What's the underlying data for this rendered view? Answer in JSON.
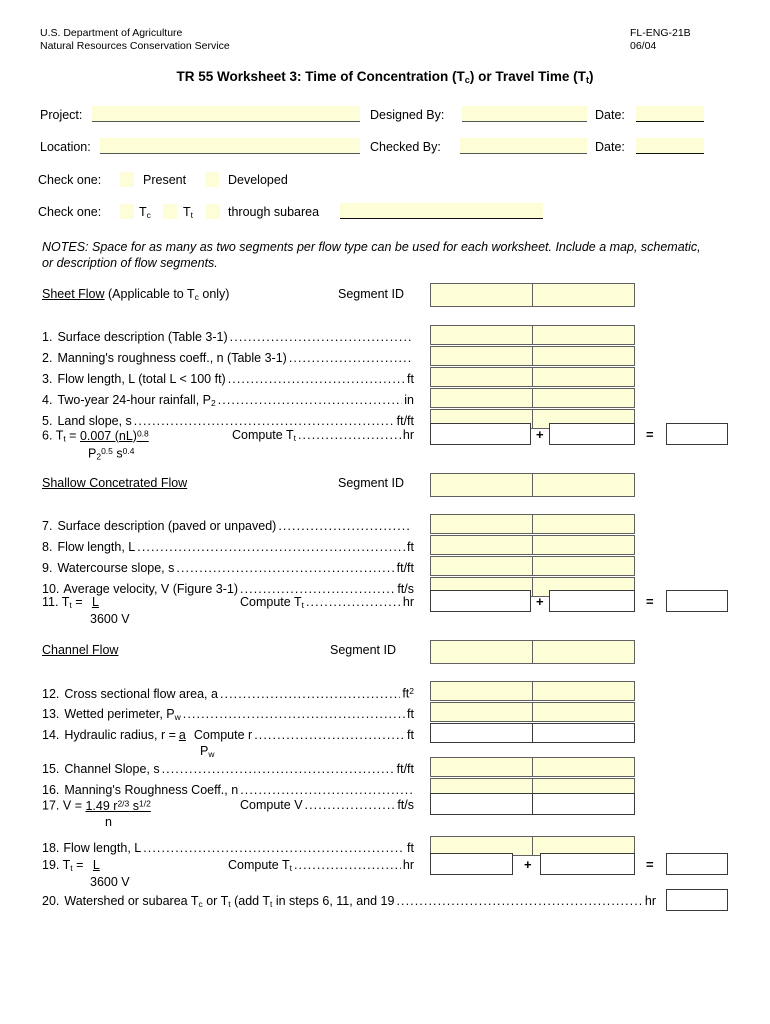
{
  "header": {
    "agency_line1": "U.S. Department of Agriculture",
    "agency_line2": "Natural Resources Conservation Service",
    "form_number": "FL-ENG-21B",
    "form_date": "06/04",
    "title_prefix": "TR 55 Worksheet 3:  Time of Concentration (T",
    "title_sub1": "c",
    "title_mid": ") or Travel Time (T",
    "title_sub2": "t",
    "title_suffix": ")"
  },
  "fields": {
    "project_label": "Project:",
    "project_value": "",
    "location_label": "Location:",
    "location_value": "",
    "designed_by_label": "Designed By:",
    "designed_by_value": "",
    "checked_by_label": "Checked By:",
    "checked_by_value": "",
    "date1_label": "Date:",
    "date1_value": "",
    "date2_label": "Date:",
    "date2_value": ""
  },
  "check_rows": {
    "row1_label": "Check one:",
    "present_label": "Present",
    "developed_label": "Developed",
    "row2_label": "Check one:",
    "tc_label": "T",
    "tc_sub": "c",
    "tt_label": "T",
    "tt_sub": "t",
    "subarea_label": "through subarea",
    "subarea_value": ""
  },
  "notes": {
    "line1": "NOTES:  Space for as many as two segments per flow type can be used for each worksheet.   Include a map, schematic,",
    "line2": "or description of flow segments."
  },
  "sections": {
    "sheet_flow": {
      "title": "Sheet Flow",
      "title_rest_a": " (Applicable to T",
      "title_rest_sub": "c",
      "title_rest_b": " only)",
      "segment_id_label": "Segment ID",
      "segment_a": "",
      "segment_b": ""
    },
    "shallow_flow": {
      "title": "Shallow Concetrated Flow",
      "segment_id_label": "Segment ID",
      "segment_a": "",
      "segment_b": ""
    },
    "channel_flow": {
      "title": "Channel Flow",
      "segment_id_label": "Segment ID",
      "segment_a": "",
      "segment_b": ""
    }
  },
  "items": {
    "i1": {
      "num": "1.",
      "text": "Surface description (Table 3-1)",
      "unit": "",
      "a": "",
      "b": ""
    },
    "i2": {
      "num": "2.",
      "text": "Manning's roughness coeff., n (Table 3-1)",
      "unit": "",
      "a": "",
      "b": ""
    },
    "i3": {
      "num": "3.",
      "text": "Flow length, L (total L < 100 ft)",
      "unit": "ft",
      "a": "",
      "b": ""
    },
    "i4": {
      "num": "4.",
      "text": "Two-year 24-hour rainfall, P",
      "text_sub": "2",
      "unit": "in",
      "a": "",
      "b": ""
    },
    "i5": {
      "num": "5.",
      "text": "Land slope, s",
      "unit": "ft/ft",
      "a": "",
      "b": ""
    },
    "i6": {
      "num": "6.",
      "var": "T",
      "var_sub": "t",
      "eq": " = ",
      "numerator": "0.007 (nL)",
      "numerator_sup": "0.8",
      "denominator_p": "P",
      "denominator_p_sub": "2",
      "denominator_p_sup": "0.5",
      "denominator_s": " s",
      "denominator_s_sup": "0.4",
      "compute": "Compute T",
      "compute_sub": "t",
      "unit": "hr",
      "a": "",
      "b": "",
      "result": "",
      "plus": "+",
      "equals": "="
    },
    "i7": {
      "num": "7.",
      "text": "Surface description (paved or unpaved)",
      "unit": "",
      "a": "",
      "b": ""
    },
    "i8": {
      "num": "8.",
      "text": "Flow length, L",
      "unit": "ft",
      "a": "",
      "b": ""
    },
    "i9": {
      "num": "9.",
      "text": "Watercourse slope, s",
      "unit": "ft/ft",
      "a": "",
      "b": ""
    },
    "i10": {
      "num": "10.",
      "text": "Average velocity, V (Figure 3-1)",
      "unit": "ft/s",
      "a": "",
      "b": ""
    },
    "i11": {
      "num": "11.",
      "var": "T",
      "var_sub": "t",
      "eq": " = ",
      "numerator": "L",
      "denominator": "3600 V",
      "compute": "Compute T",
      "compute_sub": "t",
      "unit": "hr",
      "a": "",
      "b": "",
      "result": "",
      "plus": "+",
      "equals": "="
    },
    "i12": {
      "num": "12.",
      "text": "Cross sectional flow area, a",
      "unit": "ft",
      "unit_sup": "2",
      "a": "",
      "b": ""
    },
    "i13": {
      "num": "13.",
      "text": "Wetted perimeter, P",
      "text_sub": "w",
      "unit": "ft",
      "a": "",
      "b": ""
    },
    "i14": {
      "num": "14.",
      "text": "Hydraulic radius, r = ",
      "numerator": "a",
      "denominator_p": "P",
      "denominator_sub": "w",
      "compute": "Compute r",
      "unit": "ft",
      "a": "",
      "b": ""
    },
    "i15": {
      "num": "15.",
      "text": "Channel Slope, s",
      "unit": "ft/ft",
      "a": "",
      "b": ""
    },
    "i16": {
      "num": "16.",
      "text": "Manning's Roughness Coeff., n",
      "unit": "",
      "a": "",
      "b": ""
    },
    "i17": {
      "num": "17.",
      "var": "V",
      "eq": " = ",
      "numerator_a": "1.49 r",
      "numerator_a_sup": "2/3",
      "numerator_b": " s",
      "numerator_b_sup": "1/2",
      "denominator": "n",
      "compute": "Compute V",
      "unit": "ft/s",
      "a": "",
      "b": ""
    },
    "i18": {
      "num": "18.",
      "text": "Flow length, L",
      "unit": "ft",
      "a": "",
      "b": ""
    },
    "i19": {
      "num": "19.",
      "var": "T",
      "var_sub": "t",
      "eq": " = ",
      "numerator": "L",
      "denominator": "3600 V",
      "compute": "Compute T",
      "compute_sub": "t",
      "unit": "hr",
      "a": "",
      "b": "",
      "result": "",
      "plus": "+",
      "equals": "="
    },
    "i20": {
      "num": "20.",
      "text_a": "Watershed or subarea T",
      "text_a_sub": "c",
      "text_b": " or T",
      "text_b_sub": "t",
      "text_c": " (add T",
      "text_c_sub": "t",
      "text_d": " in steps 6, 11, and 19",
      "unit": "hr",
      "result": ""
    }
  },
  "colors": {
    "field_fill": "#fdfdd8",
    "box_border": "#606060",
    "text": "#000000"
  }
}
